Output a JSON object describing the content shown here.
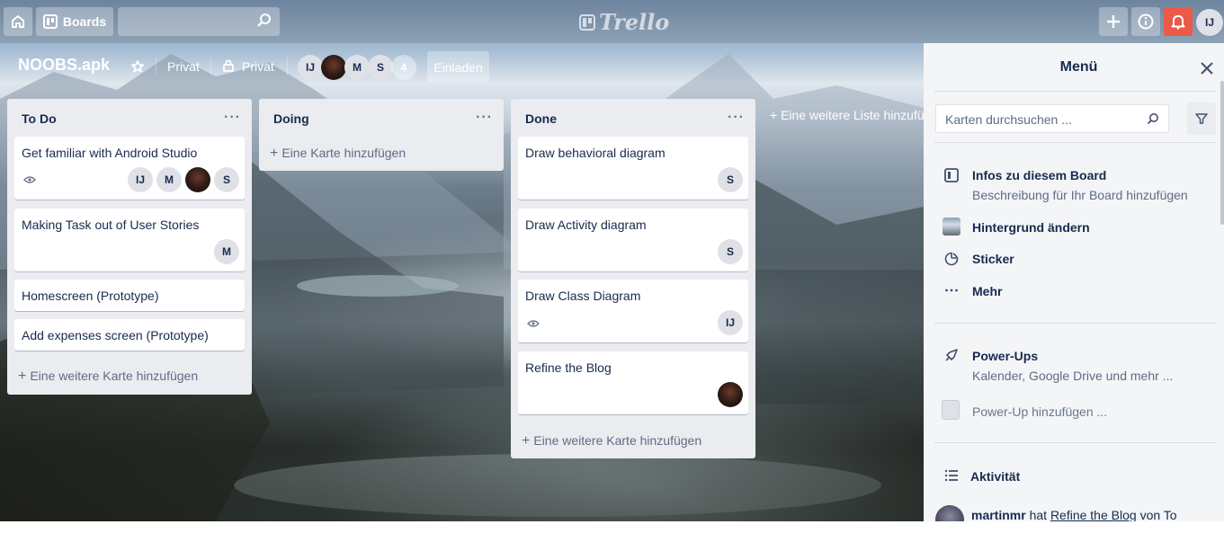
{
  "header": {
    "home_icon": "home-icon",
    "boards_label": "Boards",
    "search_placeholder": "",
    "logo_text": "Trello",
    "user_initials": "IJ"
  },
  "board": {
    "title": "NOOBS.apk",
    "visibility_label": "Privat",
    "team_label": "Privat",
    "members": [
      "IJ",
      "",
      "M",
      "S"
    ],
    "member_count": "4",
    "invite_label": "Einladen"
  },
  "lists": [
    {
      "title": "To Do",
      "cards": [
        {
          "title": "Get familiar with Android Studio",
          "members": [
            "IJ",
            "M",
            "",
            "S"
          ]
        },
        {
          "title": "Making Task out of User Stories",
          "members": [
            "M"
          ]
        },
        {
          "title": "Homescreen (Prototype)",
          "members": []
        },
        {
          "title": "Add expenses screen (Prototype)",
          "members": []
        }
      ],
      "add_card_label": "Eine weitere Karte hinzufügen"
    },
    {
      "title": "Doing",
      "cards": [],
      "add_card_label": "Eine Karte hinzufügen"
    },
    {
      "title": "Done",
      "cards": [
        {
          "title": "Draw behavioral diagram",
          "members": [
            "S"
          ]
        },
        {
          "title": "Draw Activity diagram",
          "members": [
            "S"
          ]
        },
        {
          "title": "Draw Class Diagram",
          "members": [
            "IJ"
          ]
        },
        {
          "title": "Refine the Blog",
          "members": [
            ""
          ]
        }
      ],
      "add_card_label": "Eine weitere Karte hinzufügen"
    }
  ],
  "add_list_label": "Eine weitere Liste hinzufügen",
  "menu": {
    "title": "Menü",
    "search_placeholder": "Karten durchsuchen ...",
    "items": [
      {
        "title": "Infos zu diesem Board",
        "subtitle": "Beschreibung für Ihr Board hinzufügen"
      },
      {
        "title": "Hintergrund ändern"
      },
      {
        "title": "Sticker"
      },
      {
        "title": "Mehr"
      }
    ],
    "powerups": {
      "title": "Power-Ups",
      "subtitle": "Kalender, Google Drive und mehr ...",
      "add_label": "Power-Up hinzufügen ..."
    },
    "activity": {
      "title": "Aktivität",
      "user": "martinmr",
      "verb": "hat",
      "card": "Refine the Blog",
      "rest": "von To"
    }
  },
  "colors": {
    "list_bg": "#ebecf0",
    "menu_bg": "#f4f5f7",
    "bell": "#eb5a46"
  }
}
